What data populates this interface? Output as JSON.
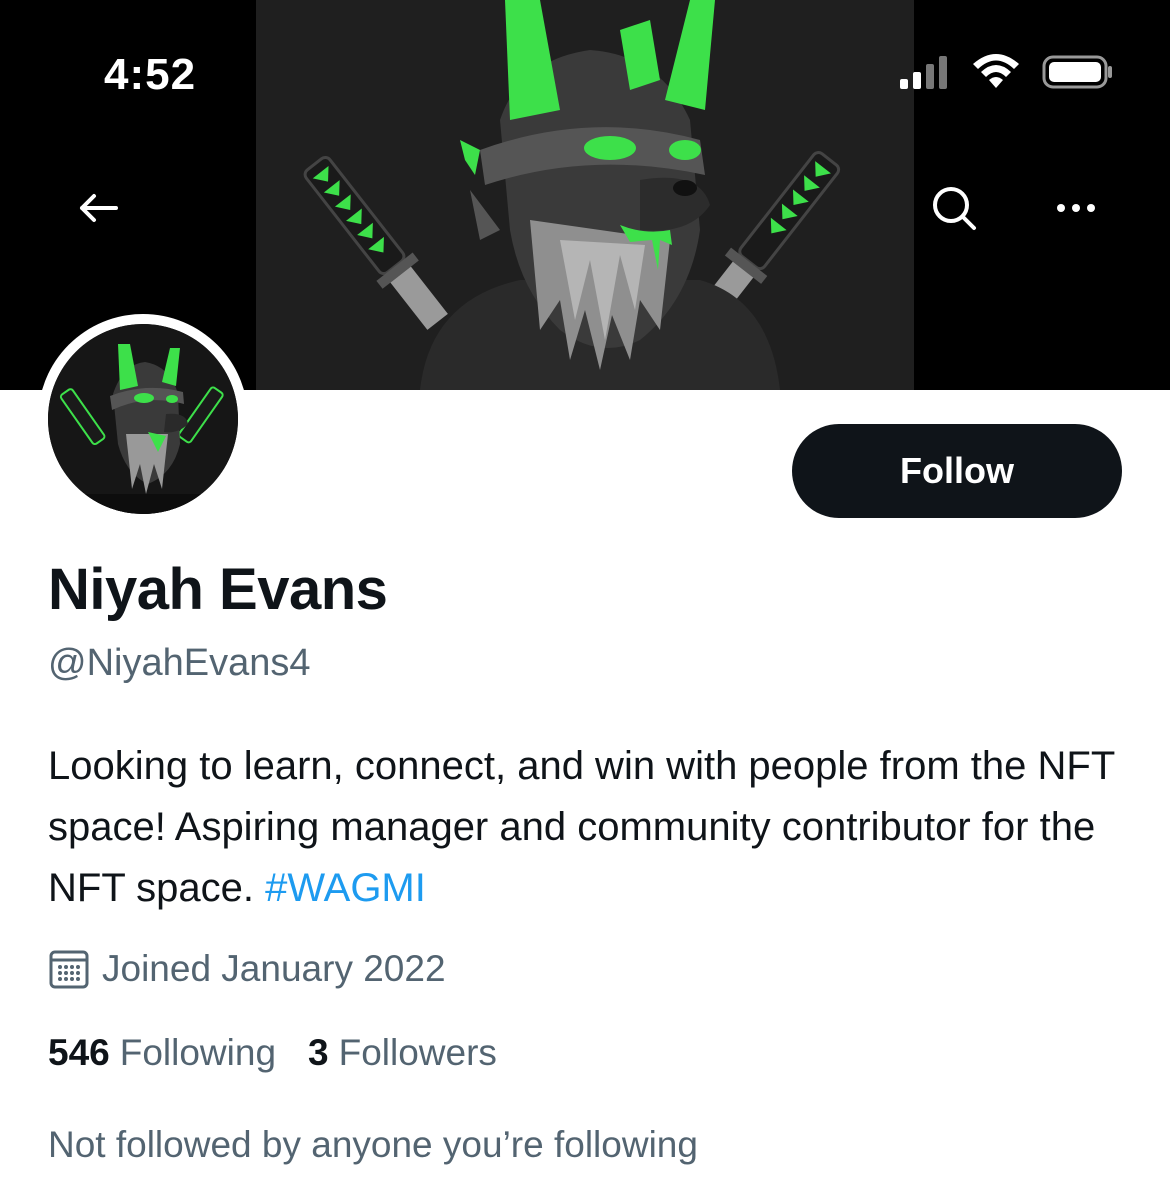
{
  "status_bar": {
    "time": "4:52"
  },
  "profile": {
    "display_name": "Niyah Evans",
    "handle": "@NiyahEvans4",
    "bio_text": "Looking to learn, connect, and win with people from the NFT space! Aspiring manager and community contributor for the NFT space.",
    "bio_hashtag": "#WAGMI",
    "joined": "Joined January 2022",
    "following_count": "546",
    "following_label": "Following",
    "followers_count": "3",
    "followers_label": "Followers",
    "mutuals_text": "Not followed by anyone you’re following"
  },
  "actions": {
    "follow_label": "Follow"
  },
  "icons": {
    "back": "back-arrow-icon",
    "search": "search-icon",
    "more": "more-icon",
    "calendar": "calendar-icon",
    "signal": "cellular-signal-icon",
    "wifi": "wifi-icon",
    "battery": "battery-icon"
  },
  "colors": {
    "accent_link": "#1d9bf0",
    "text_primary": "#0f1419",
    "text_secondary": "#536471",
    "banner_green": "#3de04a",
    "follow_button": "#0f1419"
  }
}
